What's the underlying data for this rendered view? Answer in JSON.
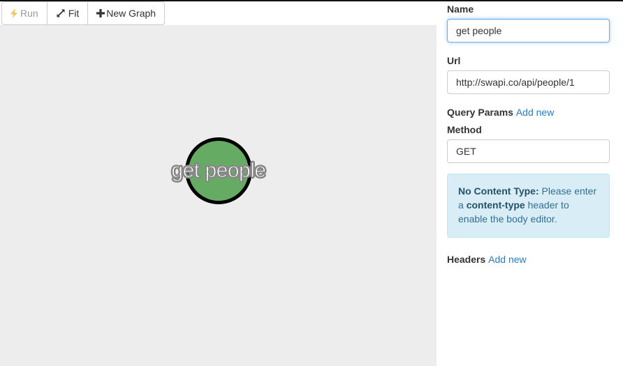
{
  "toolbar": {
    "run_label": "Run",
    "fit_label": "Fit",
    "new_graph_label": "New Graph"
  },
  "graph": {
    "nodes": [
      {
        "label": "get people",
        "color": "#65ab63"
      }
    ]
  },
  "panel": {
    "name_label": "Name",
    "name_value": "get people",
    "url_label": "Url",
    "url_value": "http://swapi.co/api/people/1",
    "query_params_label": "Query Params",
    "query_params_add": "Add new",
    "method_label": "Method",
    "method_value": "GET",
    "alert": {
      "title": "No Content Type:",
      "text_before": " Please enter a ",
      "keyword": "content-type",
      "text_after": " header to enable the body editor."
    },
    "headers_label": "Headers",
    "headers_add": "Add new"
  },
  "colors": {
    "accent_link": "#2a7ab8",
    "node_fill": "#65ab63",
    "canvas_bg": "#ededed",
    "alert_bg": "#d9edf7",
    "focus_border": "#66afe9"
  },
  "icons": {
    "run": "lightning-icon",
    "fit": "expand-icon",
    "new_graph": "plus-icon"
  }
}
